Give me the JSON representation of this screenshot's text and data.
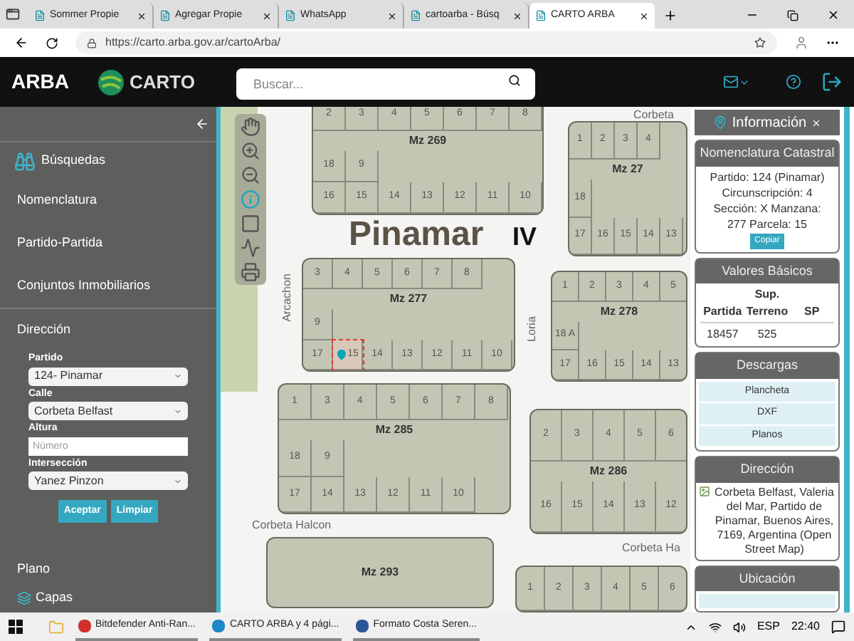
{
  "browser": {
    "tabs": [
      {
        "title": "Sommer Propie",
        "selected": false
      },
      {
        "title": "Agregar Propie",
        "selected": false
      },
      {
        "title": "WhatsApp",
        "selected": false
      },
      {
        "title": "cartoarba - Búsq",
        "selected": false
      },
      {
        "title": "CARTO ARBA",
        "selected": true
      }
    ],
    "url": "https://carto.arba.gov.ar/cartoArba/"
  },
  "app_header": {
    "logo": "ARBA",
    "brand": "CARTO",
    "search_placeholder": "Buscar..."
  },
  "sidebar": {
    "title": "Búsquedas",
    "items": [
      "Nomenclatura",
      "Partido-Partida",
      "Conjuntos Inmobiliarios",
      "Dirección"
    ],
    "form": [
      {
        "label": "Partido",
        "kind": "select",
        "value": "124- Pinamar"
      },
      {
        "label": "Calle",
        "kind": "select",
        "value": "Corbeta Belfast"
      },
      {
        "label": "Altura",
        "kind": "input",
        "placeholder": "Número"
      },
      {
        "label": "Intersección",
        "kind": "select",
        "value": "Yanez Pinzon"
      }
    ],
    "buttons": [
      "Aceptar",
      "Limpiar"
    ],
    "bottom_items": [
      "Plano",
      "Capas"
    ]
  },
  "map": {
    "place": "Pinamar",
    "place_sub": "IV",
    "blocks": [
      {
        "label": "Mz 269",
        "rows": [
          [
            {
              "n": "2",
              "selected": false
            },
            {
              "n": "3",
              "selected": false
            },
            {
              "n": "4",
              "selected": false
            },
            {
              "n": "5",
              "selected": false
            },
            {
              "n": "6",
              "selected": false
            },
            {
              "n": "7",
              "selected": false
            },
            {
              "n": "8",
              "selected": false
            }
          ],
          [
            {
              "n": "18",
              "selected": false
            },
            {
              "n": "9",
              "selected": false
            }
          ],
          [
            {
              "n": "16",
              "selected": false
            },
            {
              "n": "15",
              "selected": false
            },
            {
              "n": "14",
              "selected": false
            },
            {
              "n": "13",
              "selected": false
            },
            {
              "n": "12",
              "selected": false
            },
            {
              "n": "11",
              "selected": false
            },
            {
              "n": "10",
              "selected": false
            }
          ]
        ]
      },
      {
        "label": "Mz 27",
        "rows": [
          [
            {
              "n": "1",
              "selected": false
            },
            {
              "n": "2",
              "selected": false
            },
            {
              "n": "3",
              "selected": false
            },
            {
              "n": "4",
              "selected": false
            }
          ],
          [
            {
              "n": "18",
              "selected": false
            }
          ],
          [
            {
              "n": "17",
              "selected": false
            },
            {
              "n": "16",
              "selected": false
            },
            {
              "n": "15",
              "selected": false
            },
            {
              "n": "14",
              "selected": false
            },
            {
              "n": "13",
              "selected": false
            }
          ]
        ]
      },
      {
        "label": "Mz 277",
        "rows": [
          [
            {
              "n": "3",
              "selected": false
            },
            {
              "n": "4",
              "selected": false
            },
            {
              "n": "5",
              "selected": false
            },
            {
              "n": "6",
              "selected": false
            },
            {
              "n": "7",
              "selected": false
            },
            {
              "n": "8",
              "selected": false
            }
          ],
          [
            {
              "n": "9",
              "selected": false
            }
          ],
          [
            {
              "n": "17",
              "selected": false
            },
            {
              "n": "15",
              "selected": true
            },
            {
              "n": "14",
              "selected": false
            },
            {
              "n": "13",
              "selected": false
            },
            {
              "n": "12",
              "selected": false
            },
            {
              "n": "11",
              "selected": false
            },
            {
              "n": "10",
              "selected": false
            }
          ]
        ]
      },
      {
        "label": "Mz 278",
        "rows": [
          [
            {
              "n": "1",
              "selected": false
            },
            {
              "n": "2",
              "selected": false
            },
            {
              "n": "3",
              "selected": false
            },
            {
              "n": "4",
              "selected": false
            },
            {
              "n": "5",
              "selected": false
            }
          ],
          [
            {
              "n": "18 A",
              "selected": false
            }
          ],
          [
            {
              "n": "17",
              "selected": false
            },
            {
              "n": "16",
              "selected": false
            },
            {
              "n": "15",
              "selected": false
            },
            {
              "n": "14",
              "selected": false
            },
            {
              "n": "13",
              "selected": false
            }
          ]
        ]
      },
      {
        "label": "Mz 285",
        "rows": [
          [
            {
              "n": "1",
              "selected": false
            },
            {
              "n": "3",
              "selected": false
            },
            {
              "n": "4",
              "selected": false
            },
            {
              "n": "5",
              "selected": false
            },
            {
              "n": "6",
              "selected": false
            },
            {
              "n": "7",
              "selected": false
            },
            {
              "n": "8",
              "selected": false
            }
          ],
          [
            {
              "n": "18",
              "selected": false
            },
            {
              "n": "9",
              "selected": false
            }
          ],
          [
            {
              "n": "17",
              "selected": false
            },
            {
              "n": "14",
              "selected": false
            },
            {
              "n": "13",
              "selected": false
            },
            {
              "n": "12",
              "selected": false
            },
            {
              "n": "11",
              "selected": false
            },
            {
              "n": "10",
              "selected": false
            }
          ]
        ]
      },
      {
        "label": "Mz 286",
        "rows": [
          [
            {
              "n": "2",
              "selected": false
            },
            {
              "n": "3",
              "selected": false
            },
            {
              "n": "4",
              "selected": false
            },
            {
              "n": "5",
              "selected": false
            },
            {
              "n": "6",
              "selected": false
            }
          ],
          [],
          [
            {
              "n": "16",
              "selected": false
            },
            {
              "n": "15",
              "selected": false
            },
            {
              "n": "14",
              "selected": false
            },
            {
              "n": "13",
              "selected": false
            },
            {
              "n": "12",
              "selected": false
            }
          ]
        ]
      },
      {
        "label": "Mz 293"
      },
      {
        "rows": [
          [
            {
              "n": "1",
              "selected": false
            },
            {
              "n": "2",
              "selected": false
            },
            {
              "n": "3",
              "selected": false
            },
            {
              "n": "4",
              "selected": false
            },
            {
              "n": "5",
              "selected": false
            },
            {
              "n": "6",
              "selected": false
            }
          ]
        ]
      }
    ],
    "streets": [
      {
        "name": "Corbeta",
        "kind": "h"
      },
      {
        "name": "Arcachon",
        "kind": "v"
      },
      {
        "name": "Loria",
        "kind": "v"
      },
      {
        "name": "Corbeta Halcon",
        "kind": "h"
      },
      {
        "name": "Corbeta Ha",
        "kind": "h"
      }
    ]
  },
  "info_panel": {
    "title": "Información",
    "nomenclatura": {
      "title": "Nomenclatura Catastral",
      "lines": [
        "Partido: 124 (Pinamar)",
        "Circunscripción: 4",
        "Sección: X Manzana:",
        "277 Parcela: 15"
      ],
      "button": "Copiar"
    },
    "valores": {
      "title": "Valores Básicos",
      "columns": [
        "Partida",
        "Sup. Terreno",
        "SP"
      ],
      "row": [
        "18457",
        "525"
      ]
    },
    "descargas": {
      "title": "Descargas",
      "items": [
        "Plancheta",
        "DXF",
        "Planos"
      ]
    },
    "direccion": {
      "title": "Dirección",
      "text": "Corbeta Belfast, Valeria del Mar, Partido de Pinamar, Buenos Aires, 7169, Argentina (Open Street Map)"
    },
    "ubicacion": {
      "title": "Ubicación"
    }
  },
  "taskbar": {
    "apps": [
      "Bitdefender Anti-Ran...",
      "CARTO ARBA y 4 pági...",
      "Formato Costa Seren..."
    ],
    "lang": "ESP",
    "time": "22:40"
  }
}
